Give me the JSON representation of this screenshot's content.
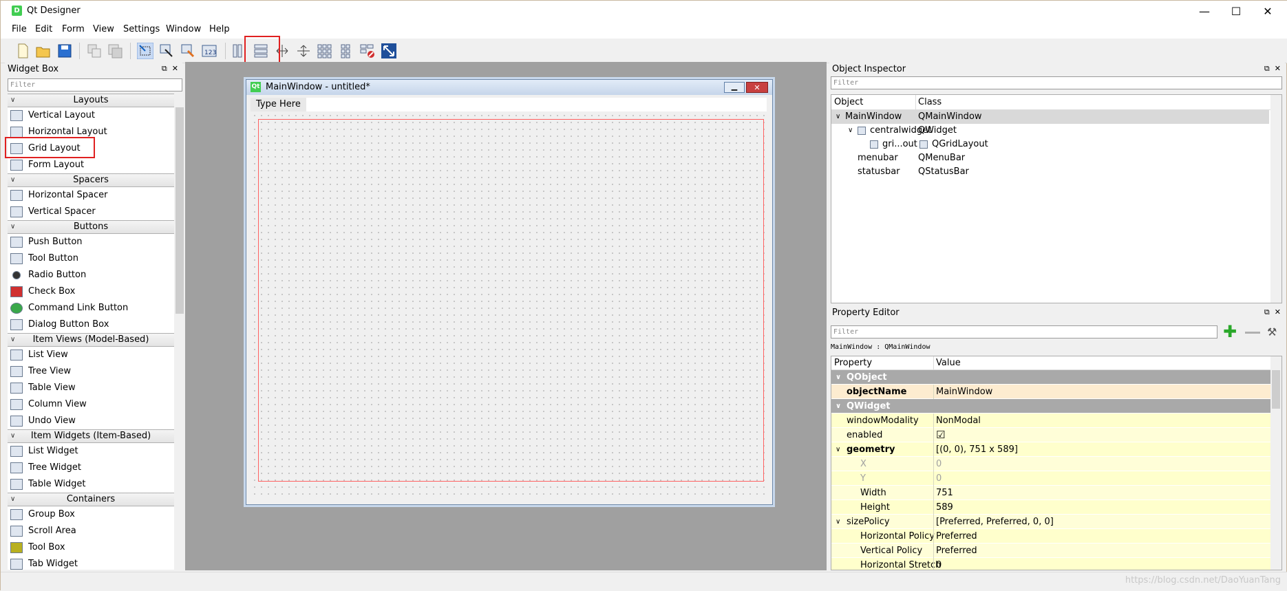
{
  "app": {
    "title": "Qt Designer",
    "icon_letter": "D",
    "minimize": "—",
    "maximize": "☐",
    "close": "✕"
  },
  "menu": [
    "File",
    "Edit",
    "Form",
    "View",
    "Settings",
    "Window",
    "Help"
  ],
  "widget_box": {
    "title": "Widget Box",
    "filter_placeholder": "Filter",
    "categories": [
      {
        "name": "Layouts",
        "items": [
          "Vertical Layout",
          "Horizontal Layout",
          "Grid Layout",
          "Form Layout"
        ]
      },
      {
        "name": "Spacers",
        "items": [
          "Horizontal Spacer",
          "Vertical Spacer"
        ]
      },
      {
        "name": "Buttons",
        "items": [
          "Push Button",
          "Tool Button",
          "Radio Button",
          "Check Box",
          "Command Link Button",
          "Dialog Button Box"
        ]
      },
      {
        "name": "Item Views (Model-Based)",
        "items": [
          "List View",
          "Tree View",
          "Table View",
          "Column View",
          "Undo View"
        ]
      },
      {
        "name": "Item Widgets (Item-Based)",
        "items": [
          "List Widget",
          "Tree Widget",
          "Table Widget"
        ]
      },
      {
        "name": "Containers",
        "items": [
          "Group Box",
          "Scroll Area",
          "Tool Box",
          "Tab Widget"
        ]
      }
    ]
  },
  "form": {
    "title": "MainWindow - untitled*",
    "menu_placeholder": "Type Here"
  },
  "object_inspector": {
    "title": "Object Inspector",
    "filter_placeholder": "Filter",
    "headers": [
      "Object",
      "Class"
    ],
    "rows": [
      {
        "object": "MainWindow",
        "class": "QMainWindow"
      },
      {
        "object": "centralwidget",
        "class": "QWidget"
      },
      {
        "object": "gri...out",
        "class": "QGridLayout"
      },
      {
        "object": "menubar",
        "class": "QMenuBar"
      },
      {
        "object": "statusbar",
        "class": "QStatusBar"
      }
    ]
  },
  "property_editor": {
    "title": "Property Editor",
    "filter_placeholder": "Filter",
    "context": "MainWindow : QMainWindow",
    "headers": [
      "Property",
      "Value"
    ],
    "rows": [
      {
        "type": "section",
        "key": "QObject",
        "value": ""
      },
      {
        "type": "prop",
        "key": "objectName",
        "value": "MainWindow"
      },
      {
        "type": "section",
        "key": "QWidget",
        "value": ""
      },
      {
        "type": "prop",
        "key": "windowModality",
        "value": "NonModal"
      },
      {
        "type": "prop",
        "key": "enabled",
        "value": "☑"
      },
      {
        "type": "prop",
        "key": "geometry",
        "value": "[(0, 0), 751 x 589]"
      },
      {
        "type": "sub",
        "key": "X",
        "value": "0"
      },
      {
        "type": "sub",
        "key": "Y",
        "value": "0"
      },
      {
        "type": "sub",
        "key": "Width",
        "value": "751"
      },
      {
        "type": "sub",
        "key": "Height",
        "value": "589"
      },
      {
        "type": "prop",
        "key": "sizePolicy",
        "value": "[Preferred, Preferred, 0, 0]"
      },
      {
        "type": "sub",
        "key": "Horizontal Policy",
        "value": "Preferred"
      },
      {
        "type": "sub",
        "key": "Vertical Policy",
        "value": "Preferred"
      },
      {
        "type": "sub",
        "key": "Horizontal Stretch",
        "value": "0"
      }
    ]
  },
  "watermark": "https://blog.csdn.net/DaoYuanTang",
  "colors": {
    "highlight": "#e02020",
    "section": "#a9a9a9",
    "prop_bg": "#ffffcc"
  }
}
